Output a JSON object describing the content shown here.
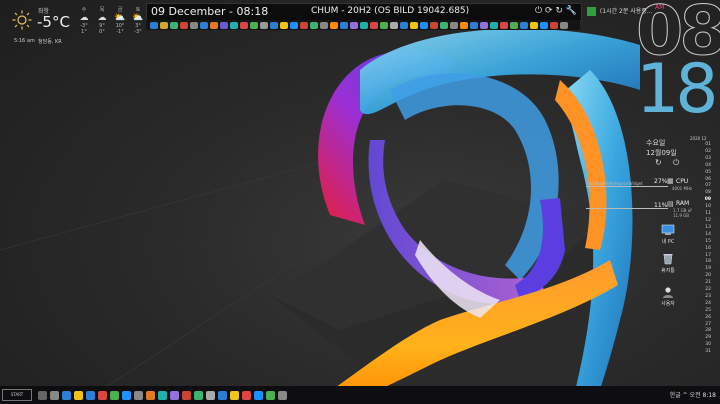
{
  "weather": {
    "location": "좌항",
    "temperature": "-5°C",
    "time": "5:16 am",
    "city": "청담동, KR",
    "forecast": [
      {
        "day": "수",
        "hi": "-3°",
        "lo": "1°",
        "icon": "cloud-icon"
      },
      {
        "day": "목",
        "hi": "9°",
        "lo": "0°",
        "icon": "cloud-icon"
      },
      {
        "day": "금",
        "hi": "10°",
        "lo": "-1°",
        "icon": "cloud-sun-icon"
      },
      {
        "day": "토",
        "hi": "3°",
        "lo": "-3°",
        "icon": "cloud-sun-icon"
      }
    ]
  },
  "topbar": {
    "date": "09 December -  08:18",
    "os": "CHUM - 20H2 (OS BILD 19042.685)",
    "icons": [
      "power-icon",
      "restart-icon",
      "refresh-icon",
      "wrench-icon"
    ]
  },
  "notification": {
    "text": "(1시간 2분 사용중...",
    "ampm": "AM"
  },
  "clock": {
    "hour": "08",
    "minute": "18"
  },
  "date_panel": {
    "weekday": "수요일",
    "month_day": "12월09일"
  },
  "calendar": {
    "year": "2020",
    "month": "12",
    "days": [
      "01",
      "02",
      "03",
      "04",
      "05",
      "06",
      "07",
      "08",
      "09",
      "10",
      "11",
      "12",
      "13",
      "14",
      "15",
      "16",
      "17",
      "18",
      "19",
      "20",
      "21",
      "22",
      "23",
      "24",
      "25",
      "26",
      "27",
      "28",
      "29",
      "30",
      "31"
    ]
  },
  "stats": {
    "cpu": {
      "label": "CPU",
      "sub": "4001 MHz",
      "pct": "27%"
    },
    "ram": {
      "label": "RAM",
      "sub": "1.7 GB of 11.9 GB",
      "pct": "11%"
    },
    "left_sub": "SmallestPerformanceWidget"
  },
  "desktop_icons": [
    {
      "name": "my-pc",
      "label": "내 PC"
    },
    {
      "name": "recycle-bin",
      "label": "휴지통"
    },
    {
      "name": "user",
      "label": "사용자"
    }
  ],
  "taskbar": {
    "start_label": "START",
    "tray_text": "한글  ^  오전 8:18"
  },
  "colors": {
    "clock_minute": "#5fb3d9",
    "am": "#ff3b8d",
    "notif_green": "#2ea043"
  }
}
